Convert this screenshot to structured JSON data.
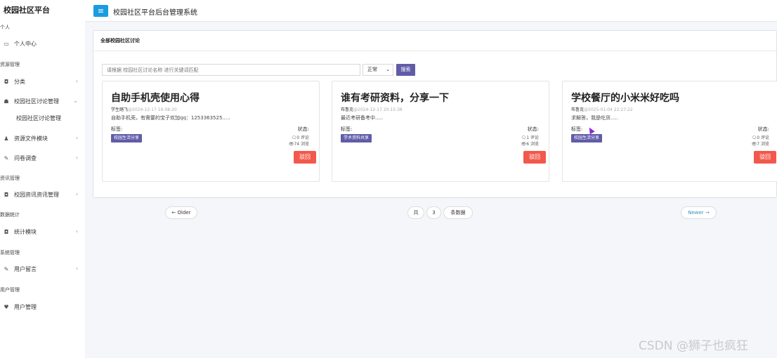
{
  "sidebar": {
    "brand": "校园社区平台",
    "sections": [
      {
        "label": "个人"
      },
      {
        "label": "资源管理"
      },
      {
        "label": "资讯管理"
      },
      {
        "label": "数据统计"
      },
      {
        "label": "系统管理"
      },
      {
        "label": "用户管理"
      }
    ],
    "items": [
      {
        "label": "个人中心",
        "icon": "monitor-icon"
      },
      {
        "label": "分类",
        "icon": "camera-icon"
      },
      {
        "label": "校园社区讨论管理",
        "icon": "users-icon"
      },
      {
        "label": "资源文件模块",
        "icon": "user-icon"
      },
      {
        "label": "问卷调查",
        "icon": "edit-icon"
      },
      {
        "label": "校园资讯资讯管理",
        "icon": "camera-icon"
      },
      {
        "label": "统计模块",
        "icon": "camera-icon"
      },
      {
        "label": "用户留言",
        "icon": "edit-icon"
      },
      {
        "label": "用户管理",
        "icon": "heart-icon"
      }
    ],
    "sub_item": "校园社区讨论管理"
  },
  "header": {
    "title": "校园社区平台后台管理系统"
  },
  "panel": {
    "title": "全部校园社区讨论",
    "search_placeholder": "请根据 校园社区讨论名称 进行关键词匹配",
    "status_value": "正常",
    "search_button": "搜索"
  },
  "cards": [
    {
      "title": "自助手机壳使用心得",
      "author": "学生踏飞",
      "date": "@2024-12-17 16:08:20",
      "excerpt": "自助手机壳，有需要的宝子欢加qq：1253363525.....",
      "tags_label": "标签:",
      "tag": "校园生活分享",
      "status_label": "状态:",
      "comments": "0 评论",
      "views": "74 浏览",
      "reject_label": "驳回"
    },
    {
      "title": "谁有考研资料，分享一下",
      "author": "布鲁克",
      "date": "@2024-12-17 20:15:38",
      "excerpt": "最近考研备考中.....",
      "tags_label": "标签:",
      "tag": "学术资料共享",
      "status_label": "状态:",
      "comments": "1 评论",
      "views": "6 浏览",
      "reject_label": "驳回"
    },
    {
      "title": "学校餐厅的小米米好吃吗",
      "author": "布鲁克",
      "date": "@2025-01-04 22:27:22",
      "excerpt": "求解答，我是吃货.....",
      "tags_label": "标签:",
      "tag": "校园生活分享",
      "status_label": "状态:",
      "comments": "0 评论",
      "views": "7 浏览",
      "reject_label": "驳回"
    }
  ],
  "pagination": {
    "older": "← Older",
    "total_prefix": "共",
    "total_count": "3",
    "total_suffix": "条数据",
    "newer": "Newer →"
  },
  "watermark": "CSDN @狮子也疯狂",
  "colors": {
    "accent": "#605ca8",
    "menu_button": "#1a9ce0",
    "danger": "#f2584b",
    "link": "#3c8dbc"
  }
}
